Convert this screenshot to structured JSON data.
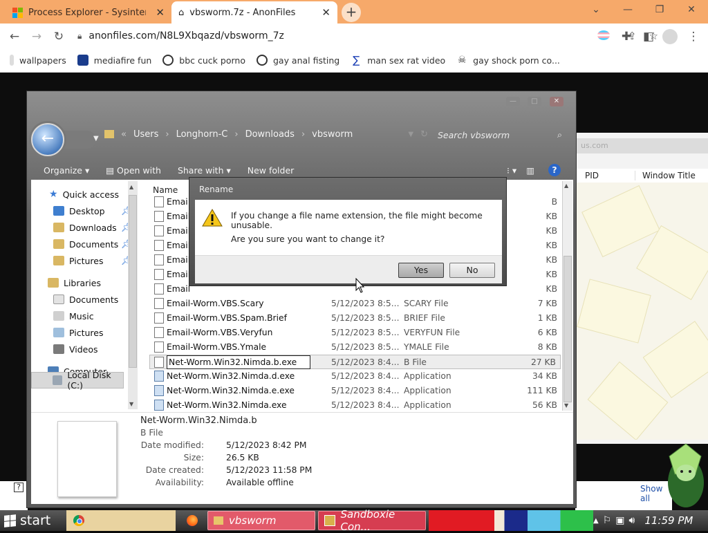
{
  "browser": {
    "tabs": [
      {
        "title": "Process Explorer - Sysinternals"
      },
      {
        "title": "vbsworm.7z - AnonFiles"
      }
    ],
    "url": "anonfiles.com/N8L9Xbqazd/vbsworm_7z",
    "bookmarks": [
      {
        "label": "wallpapers"
      },
      {
        "label": "mediafire fun"
      },
      {
        "label": "bbc cuck porno"
      },
      {
        "label": "gay anal fisting"
      },
      {
        "label": "man sex rat video"
      },
      {
        "label": "gay shock porn co..."
      }
    ]
  },
  "background_window": {
    "address_fragment": "us.com",
    "columns": [
      "PID",
      "Window Title"
    ],
    "show_all_label": "Show all"
  },
  "explorer": {
    "breadcrumb": [
      "Users",
      "Longhorn-C",
      "Downloads",
      "vbsworm"
    ],
    "search_placeholder": "Search vbsworm",
    "commands": {
      "organize": "Organize",
      "open_with": "Open with",
      "share_with": "Share with",
      "new_folder": "New folder"
    },
    "nav": {
      "quick_access": "Quick access",
      "desktop": "Desktop",
      "downloads": "Downloads",
      "documents": "Documents",
      "pictures": "Pictures",
      "libraries": "Libraries",
      "lib_documents": "Documents",
      "lib_music": "Music",
      "lib_pictures": "Pictures",
      "lib_videos": "Videos",
      "computer": "Computer",
      "local_disk": "Local Disk (C:)"
    },
    "column_header_name": "Name",
    "files": [
      {
        "name": "Emai",
        "date": "",
        "type": "",
        "size": "B"
      },
      {
        "name": "Email",
        "date": "",
        "type": "",
        "size": "KB"
      },
      {
        "name": "Email",
        "date": "",
        "type": "",
        "size": "KB"
      },
      {
        "name": "Email",
        "date": "",
        "type": "",
        "size": "KB"
      },
      {
        "name": "Email",
        "date": "",
        "type": "",
        "size": "KB"
      },
      {
        "name": "Email",
        "date": "",
        "type": "",
        "size": "KB"
      },
      {
        "name": "Email",
        "date": "",
        "type": "",
        "size": "KB"
      },
      {
        "name": "Email-Worm.VBS.Scary",
        "date": "5/12/2023 8:5...",
        "type": "SCARY File",
        "size": "7 KB"
      },
      {
        "name": "Email-Worm.VBS.Spam.Brief",
        "date": "5/12/2023 8:5...",
        "type": "BRIEF File",
        "size": "1 KB"
      },
      {
        "name": "Email-Worm.VBS.Veryfun",
        "date": "5/12/2023 8:5...",
        "type": "VERYFUN File",
        "size": "6 KB"
      },
      {
        "name": "Email-Worm.VBS.Ymale",
        "date": "5/12/2023 8:5...",
        "type": "YMALE File",
        "size": "8 KB"
      },
      {
        "name": "Net-Worm.Win32.Nimda.b.exe",
        "date": "5/12/2023 8:4...",
        "type": "B File",
        "size": "27 KB"
      },
      {
        "name": "Net-Worm.Win32.Nimda.d.exe",
        "date": "5/12/2023 8:4...",
        "type": "Application",
        "size": "34 KB"
      },
      {
        "name": "Net-Worm.Win32.Nimda.e.exe",
        "date": "5/12/2023 8:4...",
        "type": "Application",
        "size": "111 KB"
      },
      {
        "name": "Net-Worm.Win32.Nimda.exe",
        "date": "5/12/2023 8:4...",
        "type": "Application",
        "size": "56 KB"
      }
    ],
    "details": {
      "filename": "Net-Worm.Win32.Nimda.b",
      "filetype": "B File",
      "date_modified_label": "Date modified:",
      "date_modified": "5/12/2023 8:42 PM",
      "size_label": "Size:",
      "size": "26.5 KB",
      "date_created_label": "Date created:",
      "date_created": "5/12/2023 11:58 PM",
      "availability_label": "Availability:",
      "availability": "Available offline"
    }
  },
  "dialog": {
    "title": "Rename",
    "message": "If you change a file name extension, the file might become unusable.",
    "question": "Are you sure you want to change it?",
    "yes": "Yes",
    "no": "No"
  },
  "taskbar": {
    "start": "start",
    "items": [
      {
        "label": "vbsworm"
      },
      {
        "label": "Sandboxie Con..."
      }
    ],
    "clock": "11:59 PM"
  }
}
